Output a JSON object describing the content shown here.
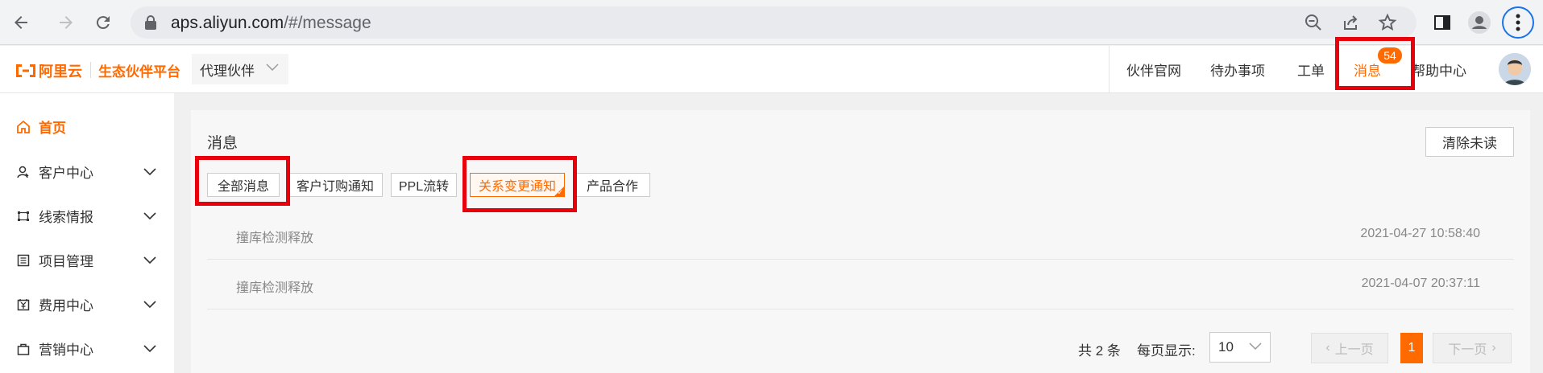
{
  "browser": {
    "url_host": "aps.aliyun.com",
    "url_path": "/#/message"
  },
  "header": {
    "logo_text": "阿里云",
    "platform": "生态伙伴平台",
    "role_select": "代理伙伴",
    "nav": {
      "partner_site": "伙伴官网",
      "todo": "待办事项",
      "ticket": "工单",
      "messages": "消息",
      "help": "帮助中心"
    },
    "message_count": "54"
  },
  "sidebar": {
    "items": [
      {
        "label": "首页",
        "icon": "home-icon"
      },
      {
        "label": "客户中心",
        "icon": "customer-icon"
      },
      {
        "label": "线索情报",
        "icon": "leads-icon"
      },
      {
        "label": "项目管理",
        "icon": "project-icon"
      },
      {
        "label": "费用中心",
        "icon": "fee-icon"
      },
      {
        "label": "营销中心",
        "icon": "marketing-icon"
      }
    ]
  },
  "main": {
    "title": "消息",
    "clear_unread": "清除未读",
    "filters": [
      "全部消息",
      "客户订购通知",
      "PPL流转",
      "关系变更通知",
      "产品合作"
    ],
    "active_filter": "关系变更通知",
    "messages": [
      {
        "title": "撞库检测释放",
        "time": "2021-04-27 10:58:40"
      },
      {
        "title": "撞库检测释放",
        "time": "2021-04-07 20:37:11"
      }
    ],
    "pagination": {
      "total": "共 2 条",
      "page_size_label": "每页显示:",
      "page_size": "10",
      "prev": "上一页",
      "current": "1",
      "next": "下一页"
    }
  },
  "colors": {
    "accent": "#ff6a00",
    "annotation": "#e8000b"
  }
}
